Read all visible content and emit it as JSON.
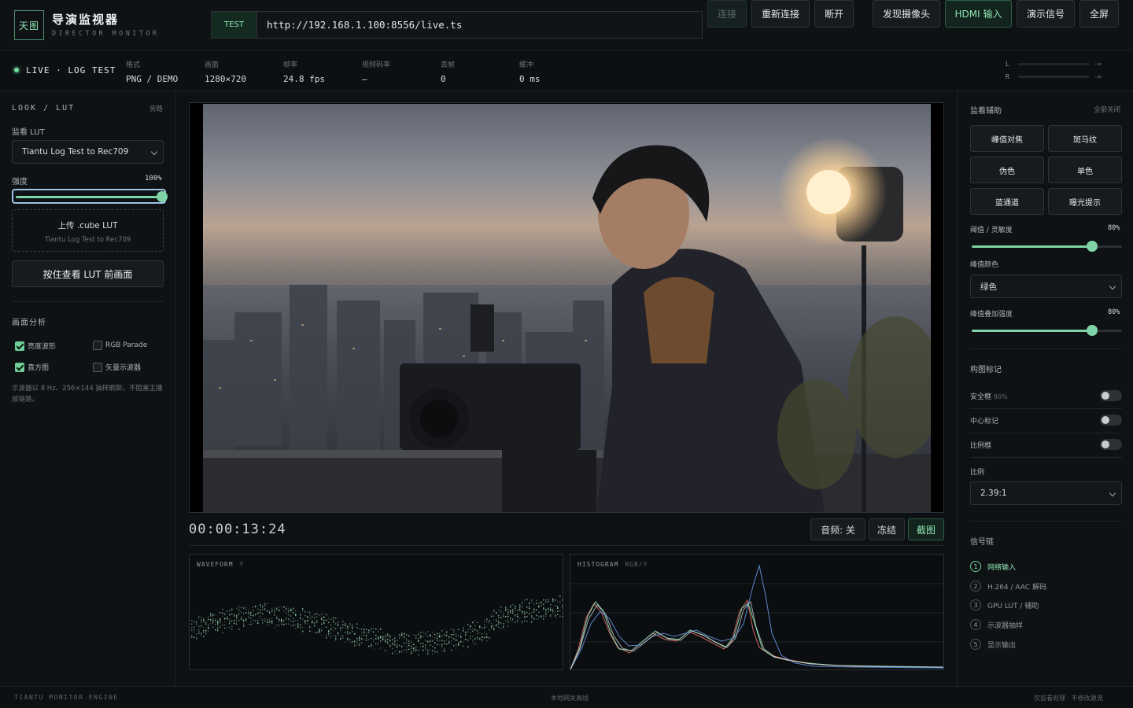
{
  "brand": {
    "logo": "天图",
    "title": "导演监视器",
    "subtitle": "DIRECTOR MONITOR"
  },
  "connection": {
    "tag": "TEST",
    "url": "http://192.168.1.100:8556/live.ts",
    "connect_label": "连接",
    "reconnect_label": "重新连接",
    "disconnect_label": "断开",
    "discover_label": "发现摄像头",
    "hdmi_label": "HDMI 输入",
    "demo_label": "演示信号",
    "fullscreen_label": "全屏"
  },
  "status": {
    "live_label": "LIVE · LOG TEST",
    "stats": [
      {
        "key": "格式",
        "value": "PNG / DEMO"
      },
      {
        "key": "画面",
        "value": "1280×720"
      },
      {
        "key": "帧率",
        "value": "24.8 fps"
      },
      {
        "key": "视频码率",
        "value": "—"
      },
      {
        "key": "丢帧",
        "value": "0"
      },
      {
        "key": "缓冲",
        "value": "0 ms"
      }
    ],
    "meters": [
      {
        "channel": "L",
        "value": "-∞"
      },
      {
        "channel": "R",
        "value": "-∞"
      }
    ]
  },
  "left": {
    "look_title": "LOOK / LUT",
    "bypass_label": "旁路",
    "lut_label": "监看 LUT",
    "lut_selected": "Tiantu Log Test to Rec709",
    "strength_label": "强度",
    "strength_value": "100%",
    "strength_level": 1.0,
    "upload_label": "上传 .cube LUT",
    "upload_current": "Tiantu Log Test to Rec709",
    "hold_label": "按住查看 LUT 前画面",
    "analysis_title": "画面分析",
    "scopes": [
      {
        "label": "亮度波形",
        "checked": true
      },
      {
        "label": "RGB Parade",
        "checked": false
      },
      {
        "label": "直方图",
        "checked": true
      },
      {
        "label": "矢量示波器",
        "checked": false
      }
    ],
    "note": "示波器以 8 Hz、256×144 抽样刷新，不阻塞主播放链路。"
  },
  "viewer": {
    "timecode": "00:00:13:24",
    "audio_label": "音频: 关",
    "freeze_label": "冻结",
    "snapshot_label": "截图",
    "waveform_label": "WAVEFORM",
    "waveform_mode": "Y",
    "histogram_label": "HISTOGRAM",
    "histogram_mode": "RGB/Y"
  },
  "right": {
    "assist_title": "监看辅助",
    "all_off_label": "全部关闭",
    "assist_buttons": [
      "峰值对焦",
      "斑马纹",
      "伪色",
      "单色",
      "蓝通道",
      "曝光提示"
    ],
    "threshold_label": "阈值 / 灵敏度",
    "threshold_value": "80%",
    "threshold_level": 0.8,
    "peak_color_label": "峰值颜色",
    "peak_color_selected": "绿色",
    "peak_strength_label": "峰值叠加强度",
    "peak_strength_value": "80%",
    "peak_strength_level": 0.8,
    "composition_title": "构图标记",
    "safe_label": "安全框",
    "safe_pct": "90%",
    "center_label": "中心标记",
    "ratio_frame_label": "比例框",
    "ratio_label": "比例",
    "ratio_selected": "2.39:1",
    "chain_title": "信号链",
    "chain": [
      {
        "num": "1",
        "label": "网络输入"
      },
      {
        "num": "2",
        "label": "H.264 / AAC 解码"
      },
      {
        "num": "3",
        "label": "GPU LUT / 辅助"
      },
      {
        "num": "4",
        "label": "示波器抽样"
      },
      {
        "num": "5",
        "label": "显示输出"
      }
    ]
  },
  "footer": {
    "engine": "TIANTU MONITOR ENGINE",
    "gateway": "本地网关离线",
    "policy": "仅监看处理 · 不修改源流"
  },
  "colors": {
    "accent": "#7fd3a7",
    "background": "#0e1113",
    "panel": "#0f1214"
  }
}
